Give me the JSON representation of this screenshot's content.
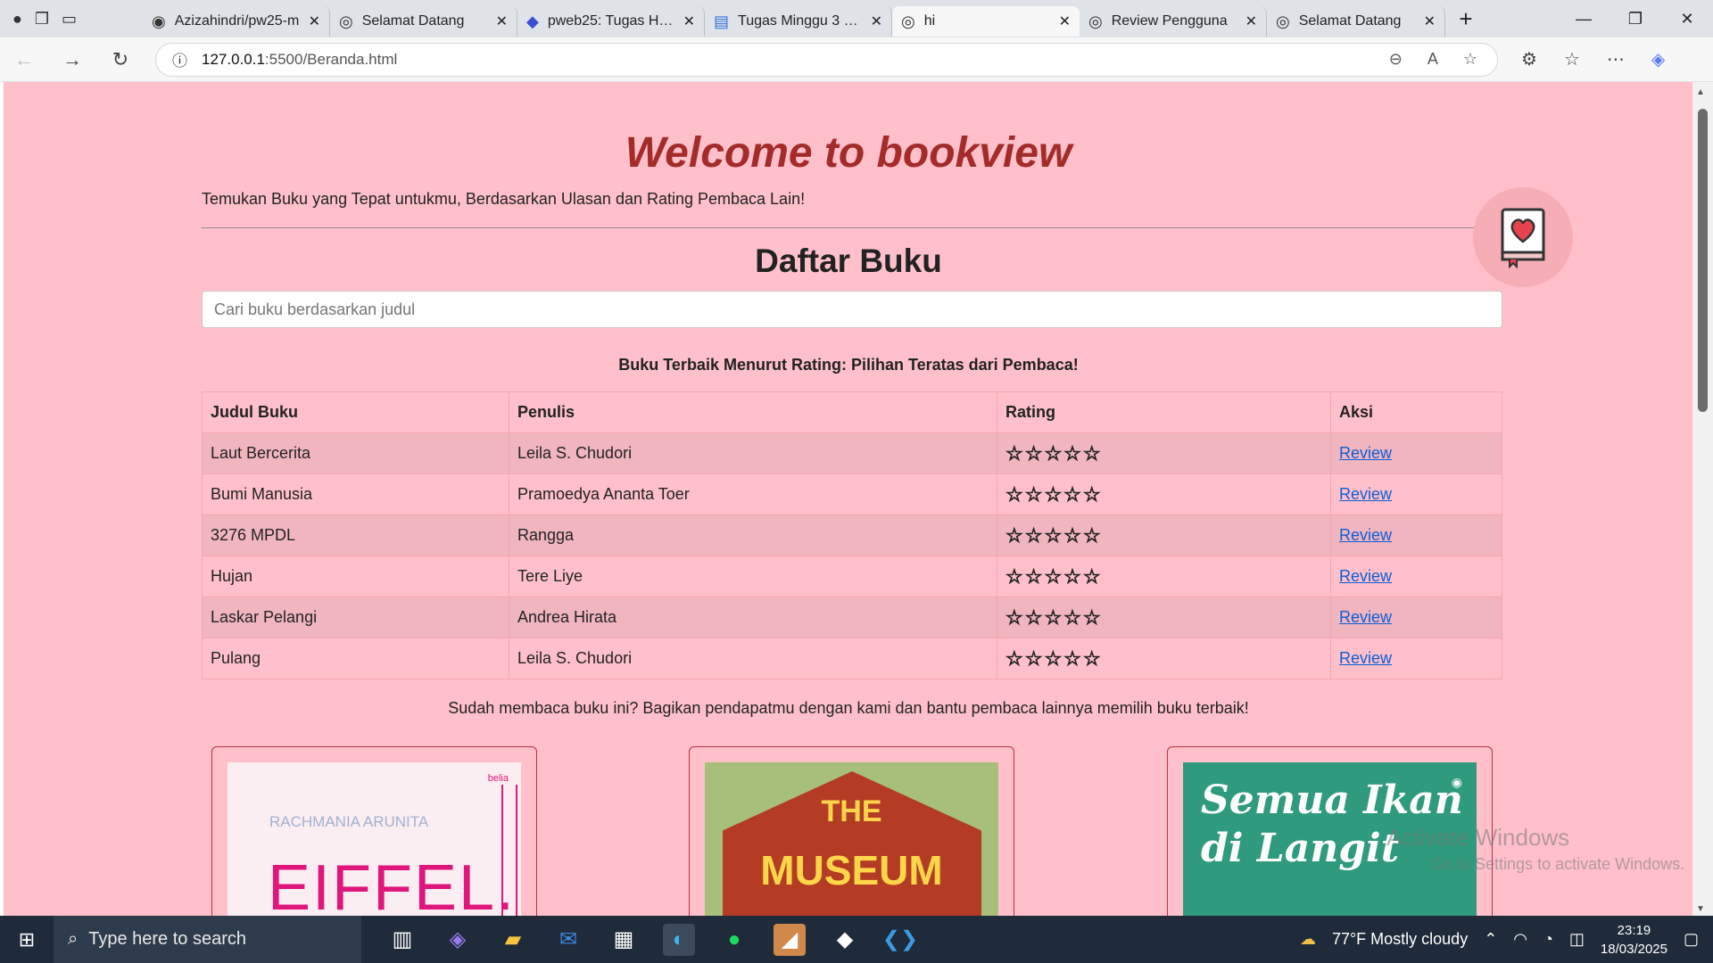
{
  "browser": {
    "tabs": [
      {
        "title": "Azizahindri/pw25-m",
        "icon": "github-icon",
        "active": false
      },
      {
        "title": "Selamat Datang",
        "icon": "globe-icon",
        "active": false
      },
      {
        "title": "pweb25: Tugas HTM",
        "icon": "edu-icon",
        "active": false
      },
      {
        "title": "Tugas Minggu 3 - H",
        "icon": "docs-icon",
        "active": false
      },
      {
        "title": "hi",
        "icon": "globe-icon",
        "active": true
      },
      {
        "title": "Review Pengguna",
        "icon": "globe-icon",
        "active": false
      },
      {
        "title": "Selamat Datang",
        "icon": "globe-icon",
        "active": false
      }
    ],
    "url_host": "127.0.0.1",
    "url_path": ":5500/Beranda.html"
  },
  "page": {
    "welcome": "Welcome to bookview",
    "tagline": "Temukan Buku yang Tepat untukmu, Berdasarkan Ulasan dan Rating Pembaca Lain!",
    "list_title": "Daftar Buku",
    "search_placeholder": "Cari buku berdasarkan judul",
    "best_heading": "Buku Terbaik Menurut Rating: Pilihan Teratas dari Pembaca!",
    "table_headers": {
      "title": "Judul Buku",
      "author": "Penulis",
      "rating": "Rating",
      "action": "Aksi"
    },
    "books": [
      {
        "title": "Laut Bercerita",
        "author": "Leila S. Chudori",
        "stars": "☆☆☆☆☆",
        "rating": 5,
        "action": "Review"
      },
      {
        "title": "Bumi Manusia",
        "author": "Pramoedya Ananta Toer",
        "stars": "☆☆☆☆☆",
        "rating": 5,
        "action": "Review"
      },
      {
        "title": "3276 MPDL",
        "author": "Rangga",
        "stars": "☆☆☆☆☆",
        "rating": 5,
        "action": "Review"
      },
      {
        "title": "Hujan",
        "author": "Tere Liye",
        "stars": "☆☆☆☆☆",
        "rating": 5,
        "action": "Review"
      },
      {
        "title": "Laskar Pelangi",
        "author": "Andrea Hirata",
        "stars": "☆☆☆☆☆",
        "rating": 5,
        "action": "Review"
      },
      {
        "title": "Pulang",
        "author": "Leila S. Chudori",
        "stars": "☆☆☆☆☆",
        "rating": 5,
        "action": "Review"
      }
    ],
    "share_text": "Sudah membaca buku ini? Bagikan pendapatmu dengan kami dan bantu pembaca lainnya memilih buku terbaik!",
    "covers": [
      {
        "author": "RACHMANIA ARUNITA",
        "title": "EIFFEL...",
        "brand": "belia"
      },
      {
        "line1": "THE",
        "line2": "MUSEUM"
      },
      {
        "title": "Semua Ikan di Langit"
      }
    ]
  },
  "watermark": {
    "line1": "Activate Windows",
    "line2": "Go to Settings to activate Windows."
  },
  "taskbar": {
    "search_text": "Type here to search",
    "weather": "77°F  Mostly cloudy",
    "time": "23:19",
    "date": "18/03/2025"
  },
  "colors": {
    "page_bg": "#ffc0cb",
    "welcome": "#a52a2a",
    "link": "#0b5ed7",
    "star": "#f5c518"
  }
}
